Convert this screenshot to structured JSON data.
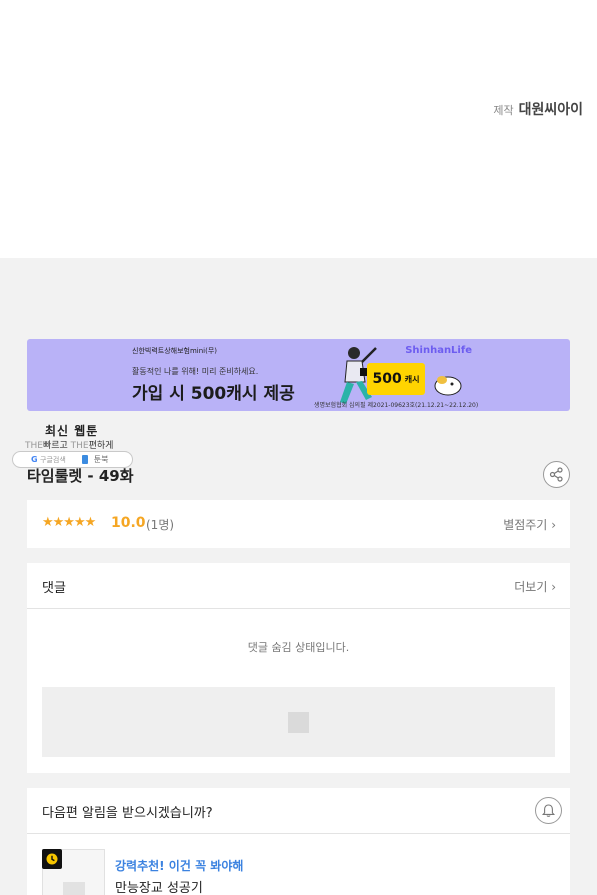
{
  "credit": {
    "label": "제작",
    "value": "대원씨아이"
  },
  "ad": {
    "line1": "신한빅력트상해보험mini(무)",
    "line2": "활동적인 나를 위해! 미리 준비하세요.",
    "headline": "가입 시 500캐시 제공",
    "brand": "ShinhanLife",
    "cash_value": "500",
    "cash_unit": "캐시",
    "fine_print": "생명보험협회 심의필 제2021-09623호(21.12.21~22.12.20)"
  },
  "promo": {
    "title": "최신 웹툰",
    "tagline_the1": "THE",
    "tagline_fast": "빠르고",
    "tagline_the2": "THE",
    "tagline_easy": "편하게",
    "search_g": "G",
    "search_label": "구글검색",
    "app_label": "툰북"
  },
  "episode": {
    "title": "타임룰렛 - 49화",
    "share_icon": "share-icon"
  },
  "rating": {
    "stars": "★★★★★",
    "score": "10.0",
    "count": "(1명)",
    "give_label": "별점주기",
    "star_color": "#f5a623"
  },
  "comments": {
    "title": "댓글",
    "more_label": "더보기",
    "hidden_message": "댓글 숨김 상태입니다."
  },
  "notify": {
    "question": "다음편 알림을 받으시겠습니까?",
    "bell_icon": "bell-icon"
  },
  "recommend": {
    "tag": "강력추천! 이건 꼭 봐야해",
    "title": "만능장교 성공기",
    "tag_color": "#3b82e0"
  }
}
